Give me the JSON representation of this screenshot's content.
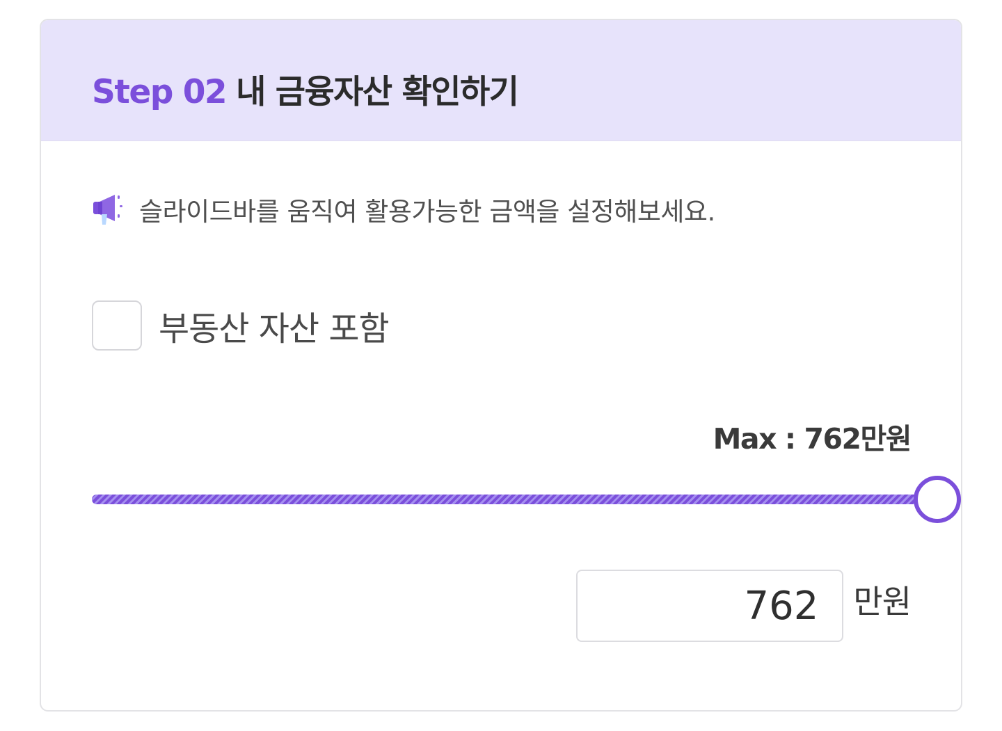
{
  "header": {
    "step_label": "Step 02",
    "title": "내 금융자산 확인하기"
  },
  "notice": {
    "icon": "megaphone-icon",
    "text": "슬라이드바를 움직여 활용가능한 금액을 설정해보세요."
  },
  "real_estate_option": {
    "label": "부동산 자산 포함",
    "checked": false
  },
  "slider": {
    "max_text": "Max : 762만원",
    "max_value": 762,
    "value": 762,
    "fraction": 1.0
  },
  "amount": {
    "value": "762",
    "unit": "만원"
  },
  "colors": {
    "accent": "#7b4fdb",
    "header_bg": "#e7e3fb",
    "border": "#e3e3e6"
  }
}
